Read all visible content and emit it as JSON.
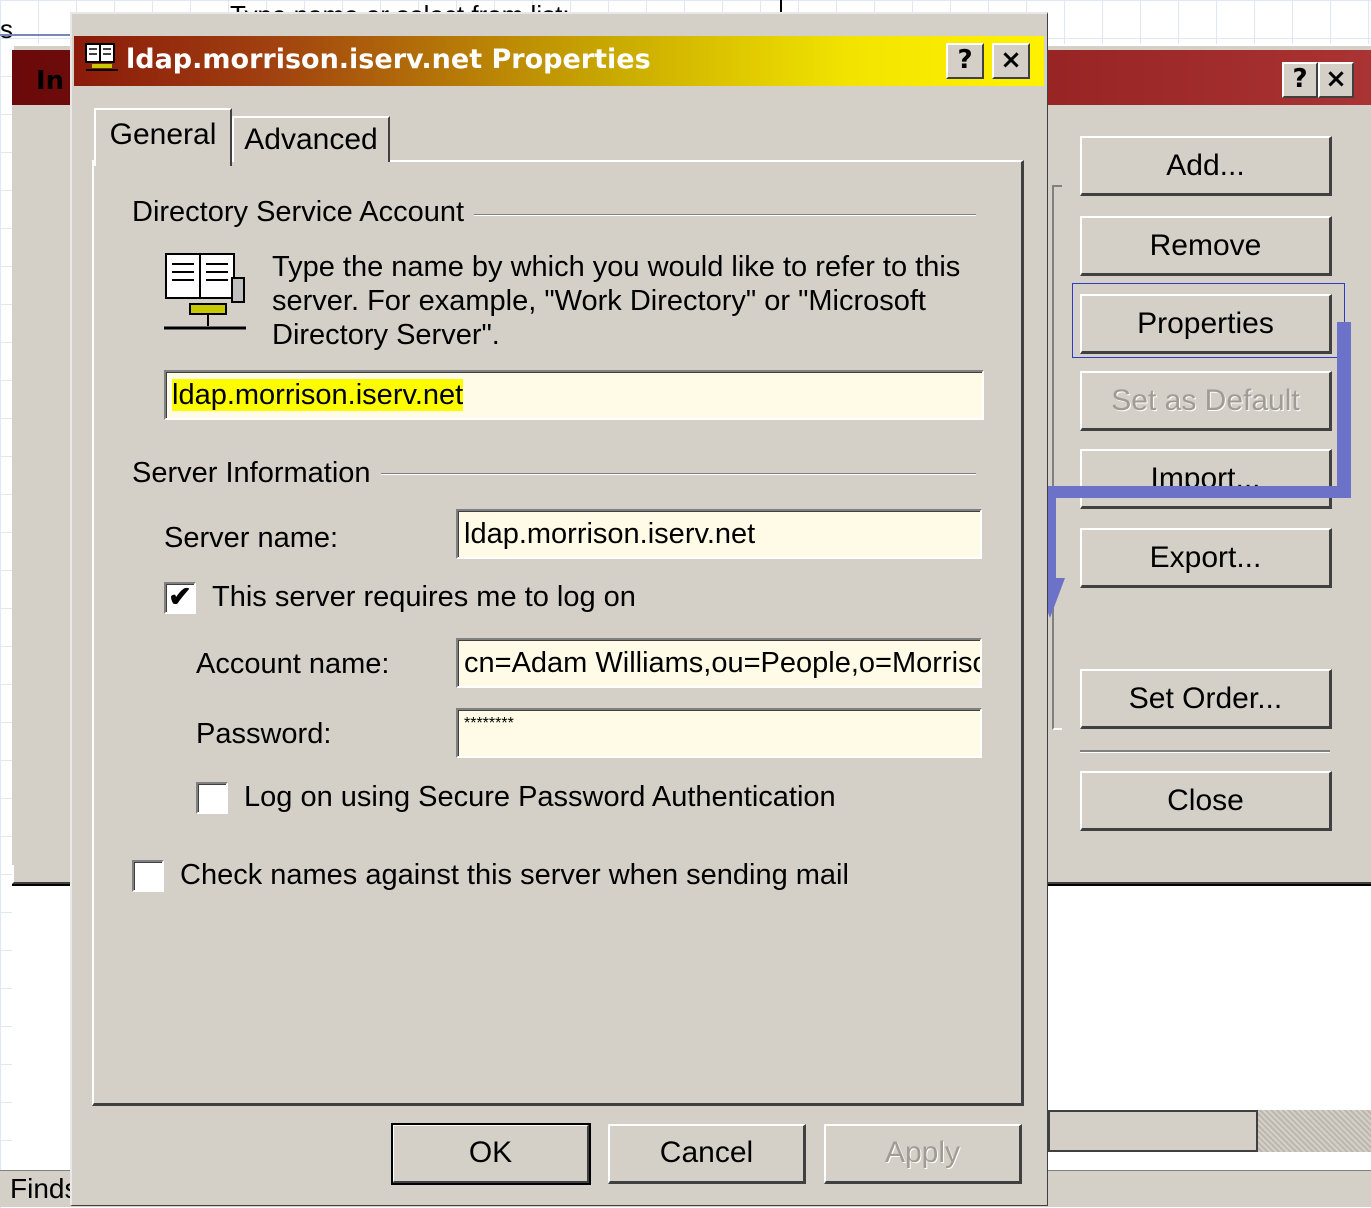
{
  "background": {
    "top_label": "s",
    "top_input_text": "Type name or select from list:",
    "window_title_partial": "In",
    "help_glyph": "?",
    "close_glyph": "×",
    "status_text": "Finds",
    "buttons": {
      "add": "Add...",
      "remove": "Remove",
      "properties": "Properties",
      "set_default": "Set as Default",
      "import": "Import...",
      "export": "Export...",
      "set_order": "Set Order...",
      "close": "Close"
    }
  },
  "dialog": {
    "title": "ldap.morrison.iserv.net Properties",
    "help_glyph": "?",
    "close_glyph": "×",
    "tabs": {
      "general": "General",
      "advanced": "Advanced"
    },
    "directory_account": {
      "group_label": "Directory Service Account",
      "description": "Type the name by which you would like to refer to this server. For example, \"Work Directory\" or \"Microsoft Directory Server\".",
      "account_display_name": "ldap.morrison.iserv.net"
    },
    "server_info": {
      "group_label": "Server Information",
      "server_name_label": "Server name:",
      "server_name_value": "ldap.morrison.iserv.net",
      "requires_logon_label": "This server requires me to log on",
      "requires_logon_checked": "✔",
      "account_name_label": "Account name:",
      "account_name_value": "cn=Adam Williams,ou=People,o=Morrison",
      "password_label": "Password:",
      "password_value": "********",
      "spa_label": "Log on using Secure Password Authentication",
      "spa_checked": ""
    },
    "check_names_label": "Check names against this server when sending mail",
    "check_names_checked": "",
    "buttons": {
      "ok": "OK",
      "cancel": "Cancel",
      "apply": "Apply"
    }
  },
  "colors": {
    "dialog_face": "#d4d0c8",
    "field_bg": "#fffbe6",
    "highlight": "#fdfd00",
    "annotation": "#6c72c8"
  }
}
